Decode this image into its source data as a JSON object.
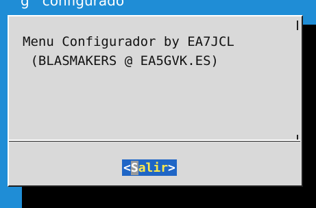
{
  "background_hint": "g ... configurado ... [truncated]",
  "dialog": {
    "message_line1": "Menu Configurador by EA7JCL",
    "message_line2": " (BLASMAKERS @ EA5GVK.ES)"
  },
  "button": {
    "open_bracket": "<",
    "hotkey": "S",
    "rest": "alir",
    "close_bracket": ">"
  },
  "colors": {
    "desktop": "#1f8dd6",
    "dialog": "#d9d9d9",
    "button_bg": "#1f66c6",
    "button_text": "#ffe94a"
  }
}
